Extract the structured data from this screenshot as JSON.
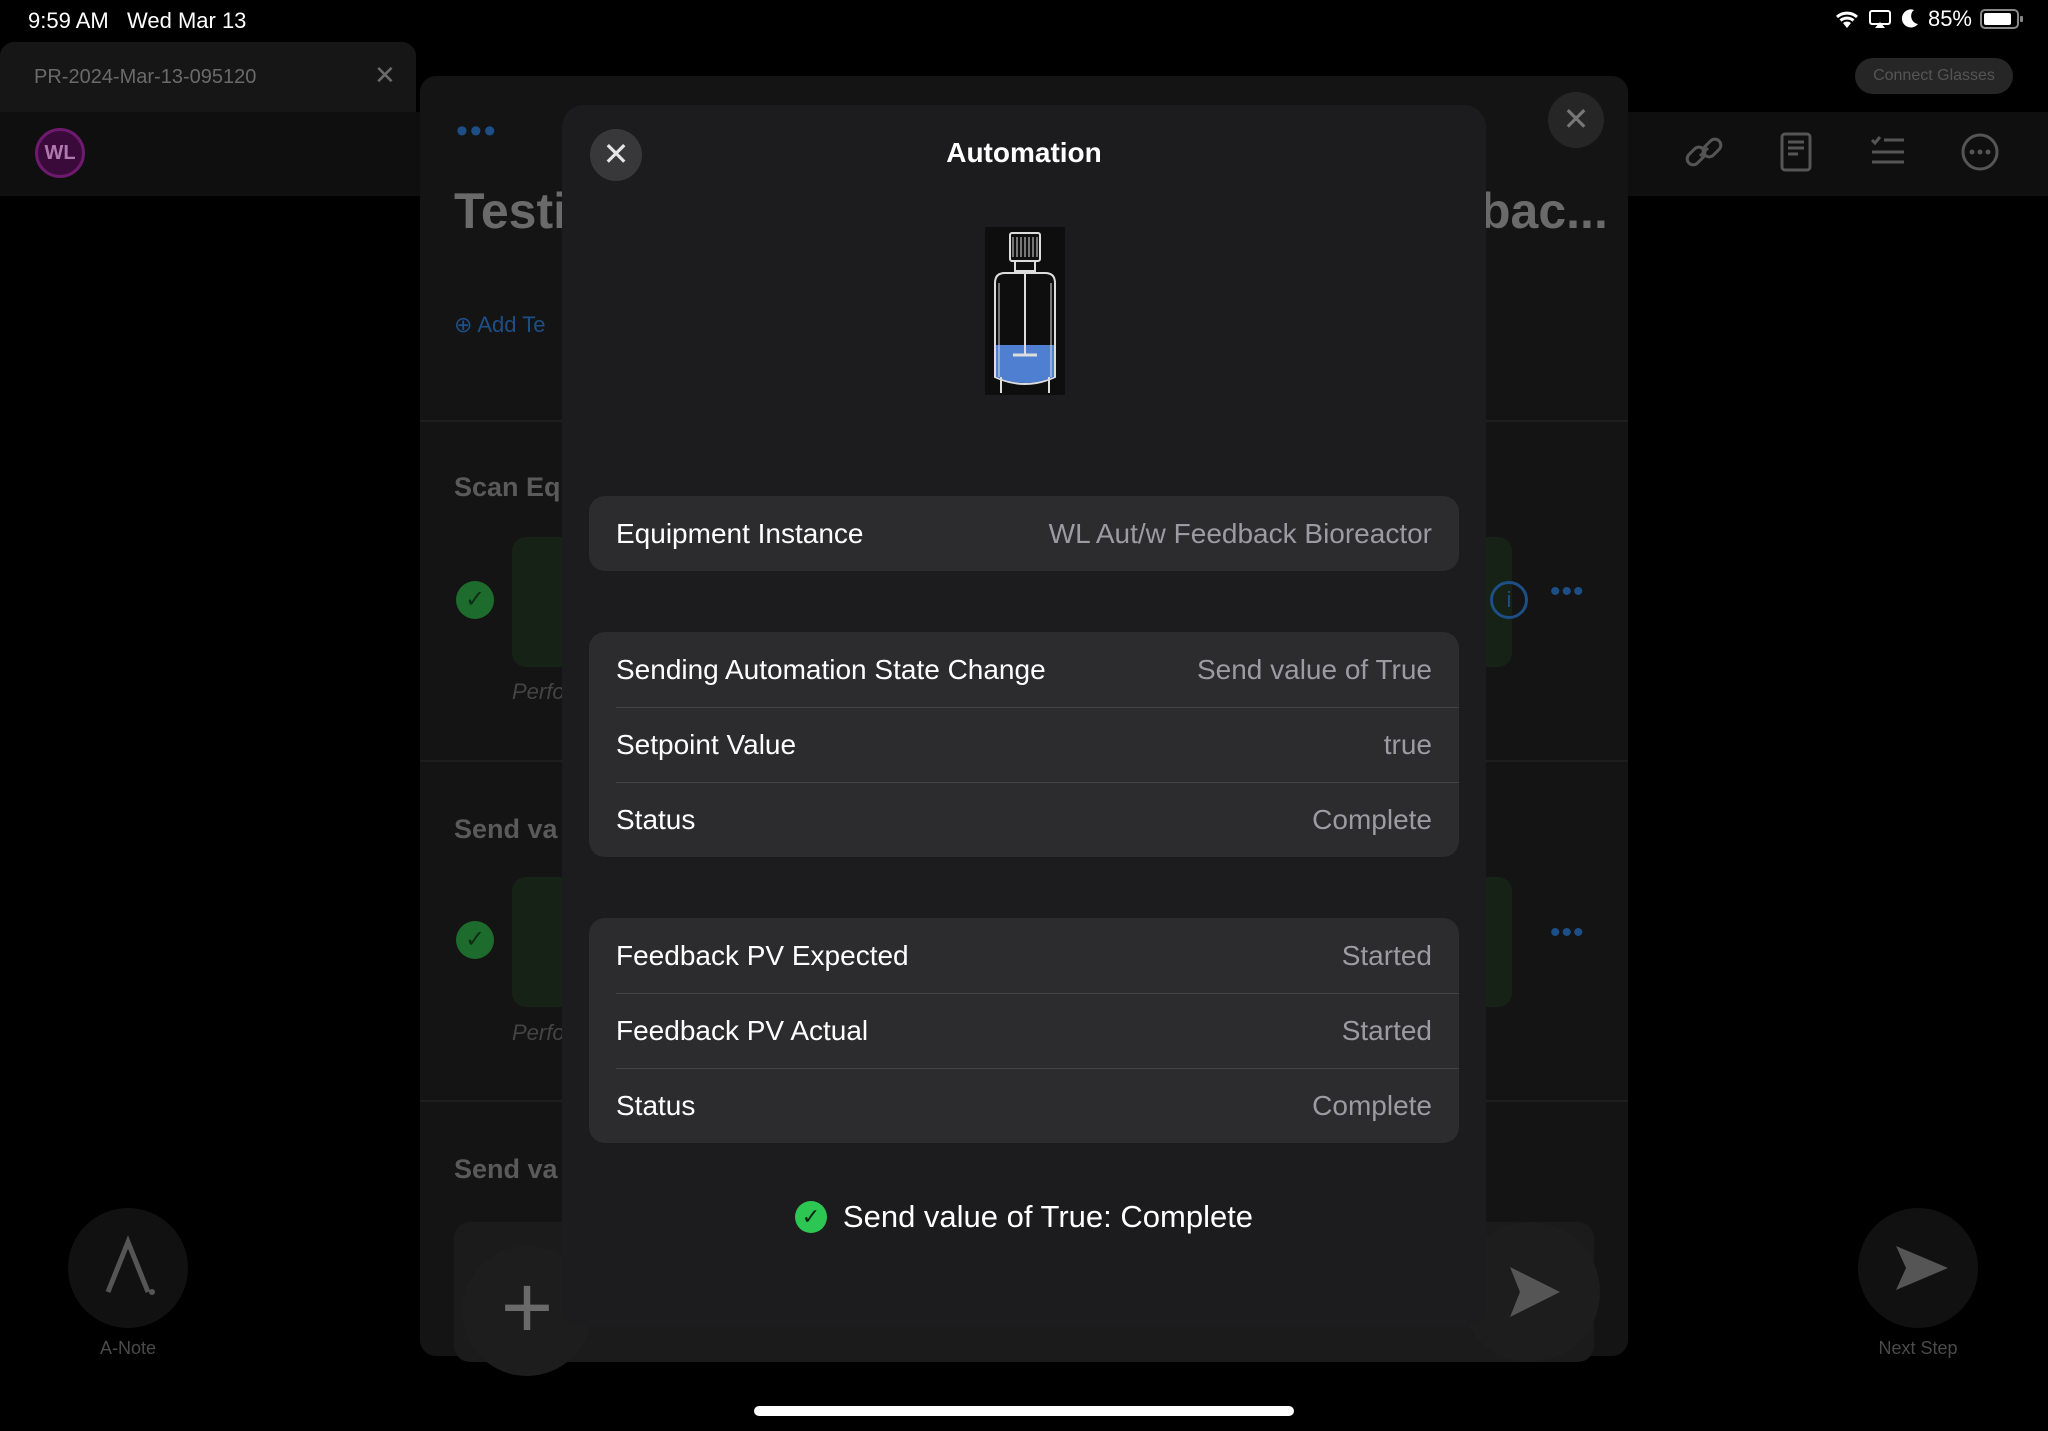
{
  "status_bar": {
    "time": "9:59 AM",
    "date": "Wed Mar 13",
    "battery": "85%"
  },
  "background": {
    "tab_label": "PR-2024-Mar-13-095120",
    "connect_glasses": "Connect Glasses",
    "avatar_initials": "WL",
    "title_left": "Testi",
    "title_right": "bac...",
    "add_tag": "Add Te",
    "sections": [
      {
        "title": "Scan Eq",
        "performed": "Perfo"
      },
      {
        "title": "Send va",
        "performed": "Perfo"
      },
      {
        "title": "Send va"
      }
    ],
    "a_note_label": "A-Note",
    "next_step_label": "Next Step"
  },
  "modal": {
    "title": "Automation",
    "equipment": {
      "label": "Equipment Instance",
      "value": "WL Aut/w Feedback Bioreactor"
    },
    "state_change": [
      {
        "label": "Sending Automation State Change",
        "value": "Send value of True"
      },
      {
        "label": "Setpoint Value",
        "value": "true"
      },
      {
        "label": "Status",
        "value": "Complete"
      }
    ],
    "feedback": [
      {
        "label": "Feedback PV Expected",
        "value": "Started"
      },
      {
        "label": "Feedback PV Actual",
        "value": "Started"
      },
      {
        "label": "Status",
        "value": "Complete"
      }
    ],
    "summary": "Send value of True: Complete"
  },
  "colors": {
    "accent_blue": "#1d4f86",
    "success_green": "#2dc653",
    "modal_bg": "#1c1c1e",
    "group_bg": "#2c2c2e"
  }
}
